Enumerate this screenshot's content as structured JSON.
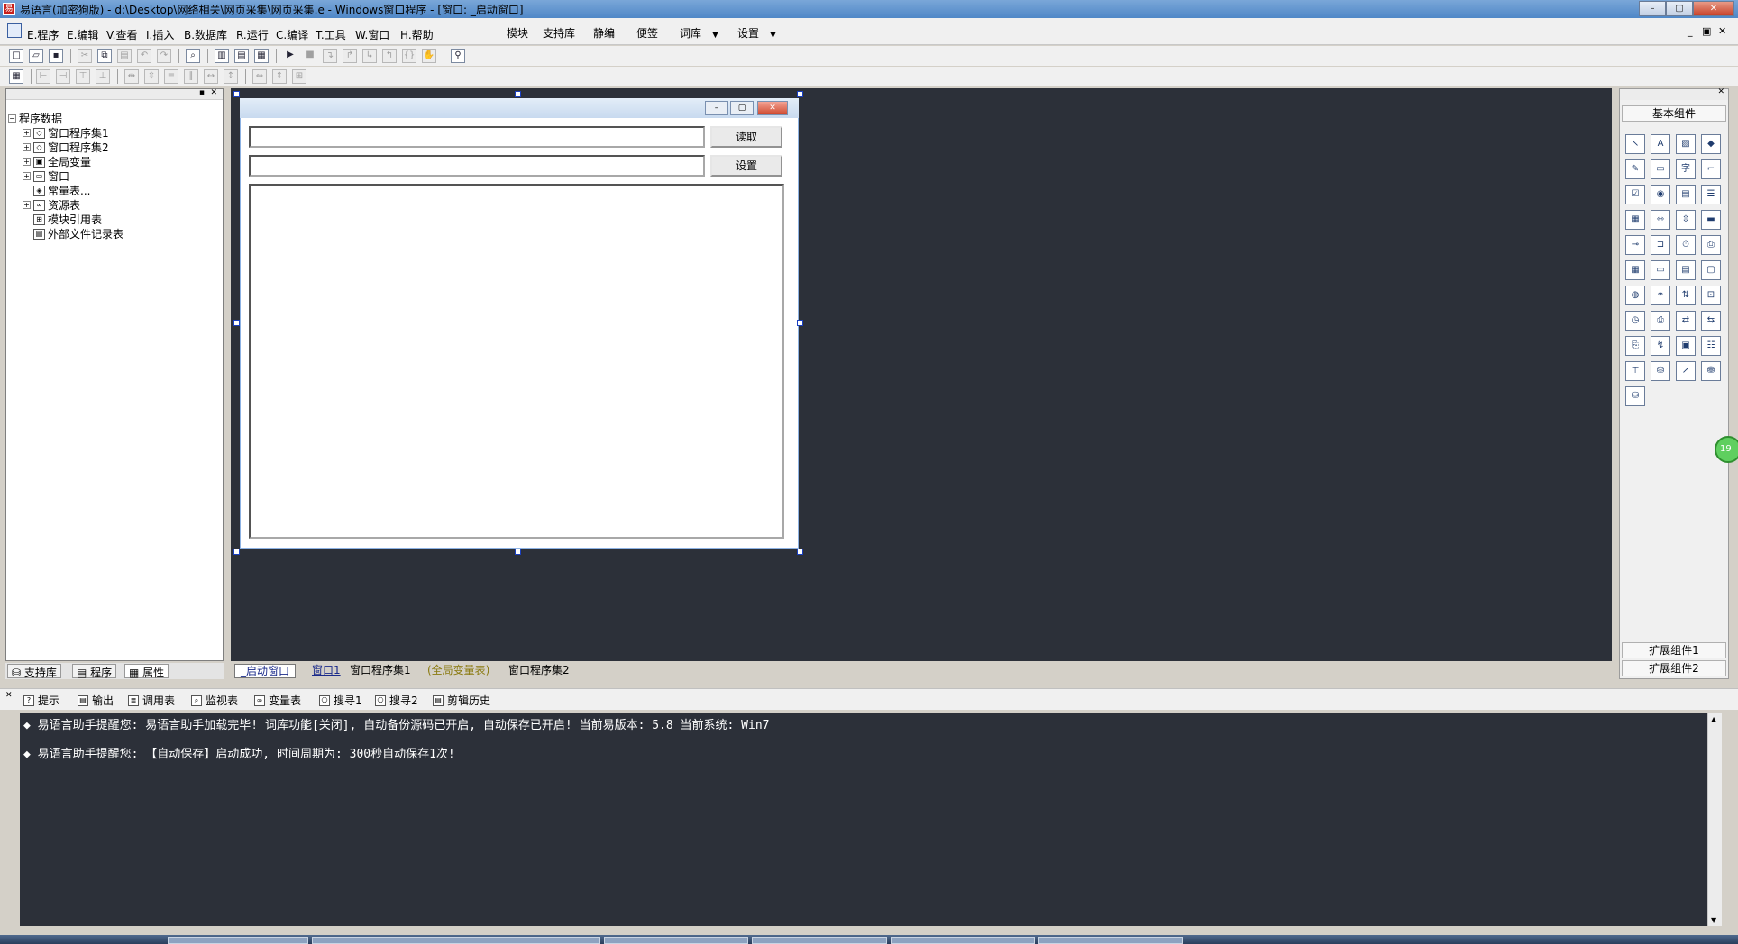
{
  "window": {
    "title": "易语言(加密狗版) - d:\\Desktop\\网络相关\\网页采集\\网页采集.e - Windows窗口程序 - [窗口: _启动窗口]",
    "min": "–",
    "max": "▢",
    "close": "✕"
  },
  "menu": {
    "items": [
      "E.程序",
      "E.编辑",
      "V.查看",
      "I.插入",
      "B.数据库",
      "R.运行",
      "C.编译",
      "T.工具",
      "W.窗口",
      "H.帮助"
    ],
    "extras": [
      "模块",
      "支持库",
      "静编",
      "便签",
      "词库",
      "设置"
    ]
  },
  "left_panel": {
    "root": "程序数据",
    "items": [
      "窗口程序集1",
      "窗口程序集2",
      "全局变量",
      "窗口",
      "常量表...",
      "资源表",
      "模块引用表",
      "外部文件记录表"
    ],
    "tabs": [
      "支持库",
      "程序",
      "属性"
    ]
  },
  "form": {
    "read_button": "读取",
    "set_button": "设置",
    "input1_value": "",
    "input2_value": "",
    "memo_value": ""
  },
  "doc_tabs": [
    "_启动窗口",
    "窗口1",
    "窗口程序集1",
    "(全局变量表)",
    "窗口程序集2"
  ],
  "right_panel": {
    "header": "基本组件",
    "footer1": "扩展组件1",
    "footer2": "扩展组件2",
    "badge": "19"
  },
  "output_tabs": [
    "提示",
    "输出",
    "调用表",
    "监视表",
    "变量表",
    "搜寻1",
    "搜寻2",
    "剪辑历史"
  ],
  "output_lines": [
    "◆ 易语言助手提醒您:  易语言助手加载完毕!  词库功能[关闭], 自动备份源码已开启, 自动保存已开启!  当前易版本: 5.8  当前系统: Win7",
    "◆ 易语言助手提醒您: 【自动保存】启动成功, 时间周期为: 300秒自动保存1次!"
  ]
}
